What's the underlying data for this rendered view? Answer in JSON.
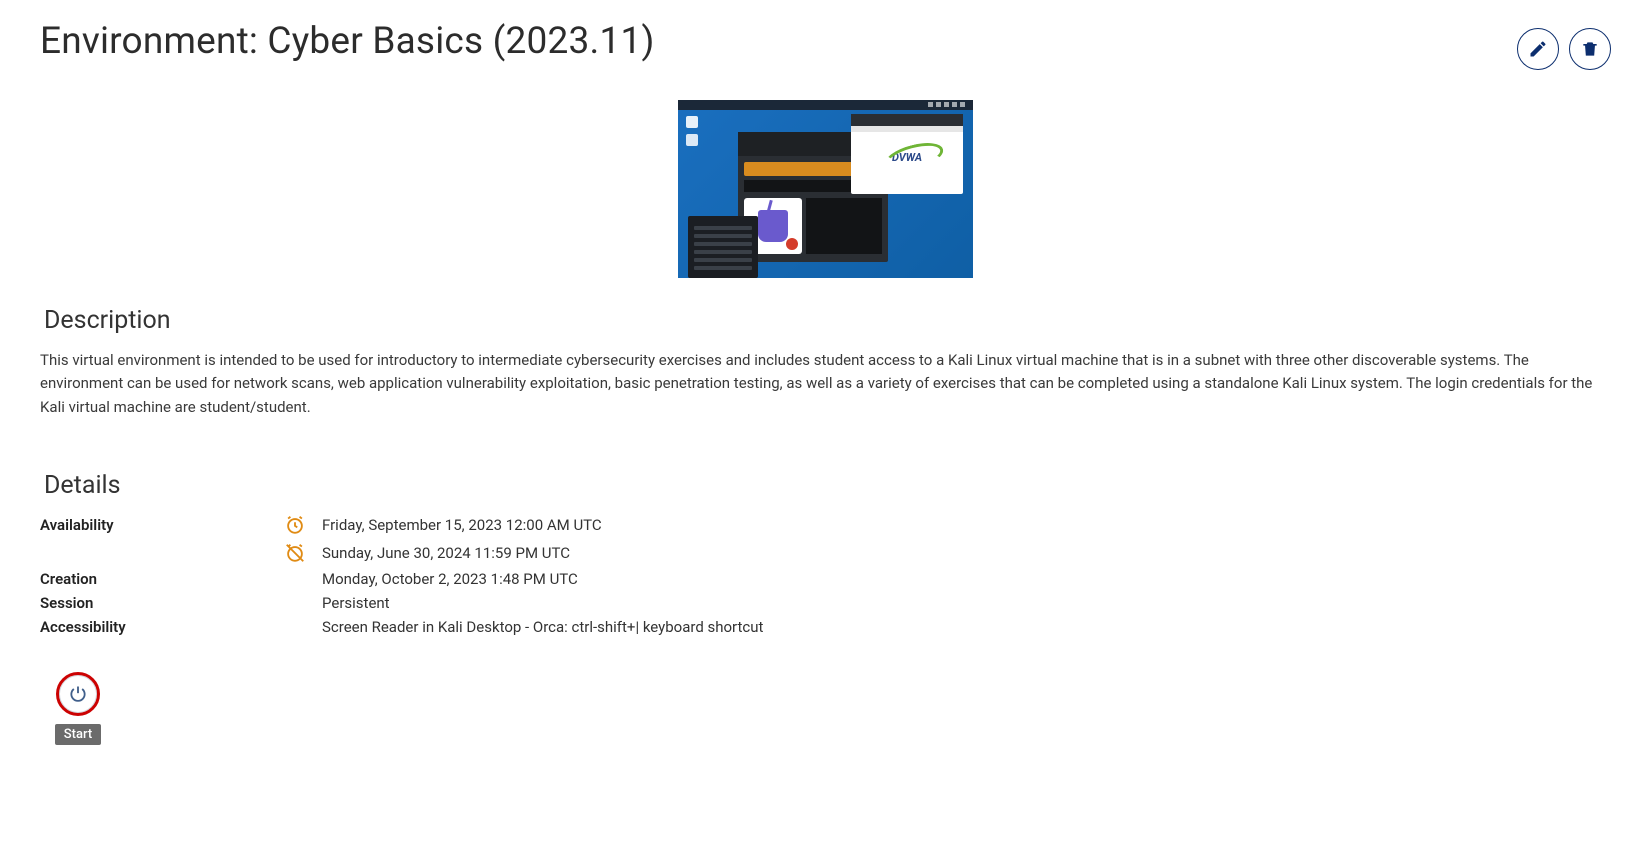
{
  "header": {
    "title": "Environment: Cyber Basics (2023.11)"
  },
  "sections": {
    "description_title": "Description",
    "details_title": "Details"
  },
  "description": {
    "text": "This virtual environment is intended to be used for introductory to intermediate cybersecurity exercises and includes student access to a Kali Linux virtual machine that is in a subnet with three other discoverable systems. The environment can be used for network scans, web application vulnerability exploitation, basic penetration testing, as well as a variety of exercises that can be completed using a standalone Kali Linux system. The login credentials for the Kali virtual machine are student/student."
  },
  "details": {
    "availability_label": "Availability",
    "availability_start": "Friday, September 15, 2023 12:00 AM UTC",
    "availability_end": "Sunday, June 30, 2024 11:59 PM UTC",
    "creation_label": "Creation",
    "creation_value": "Monday, October 2, 2023 1:48 PM UTC",
    "session_label": "Session",
    "session_value": "Persistent",
    "accessibility_label": "Accessibility",
    "accessibility_value": "Screen Reader in Kali Desktop - Orca: ctrl-shift+| keyboard shortcut"
  },
  "actions": {
    "start_tooltip": "Start"
  },
  "screenshot": {
    "dvwa_label": "DVWA"
  }
}
